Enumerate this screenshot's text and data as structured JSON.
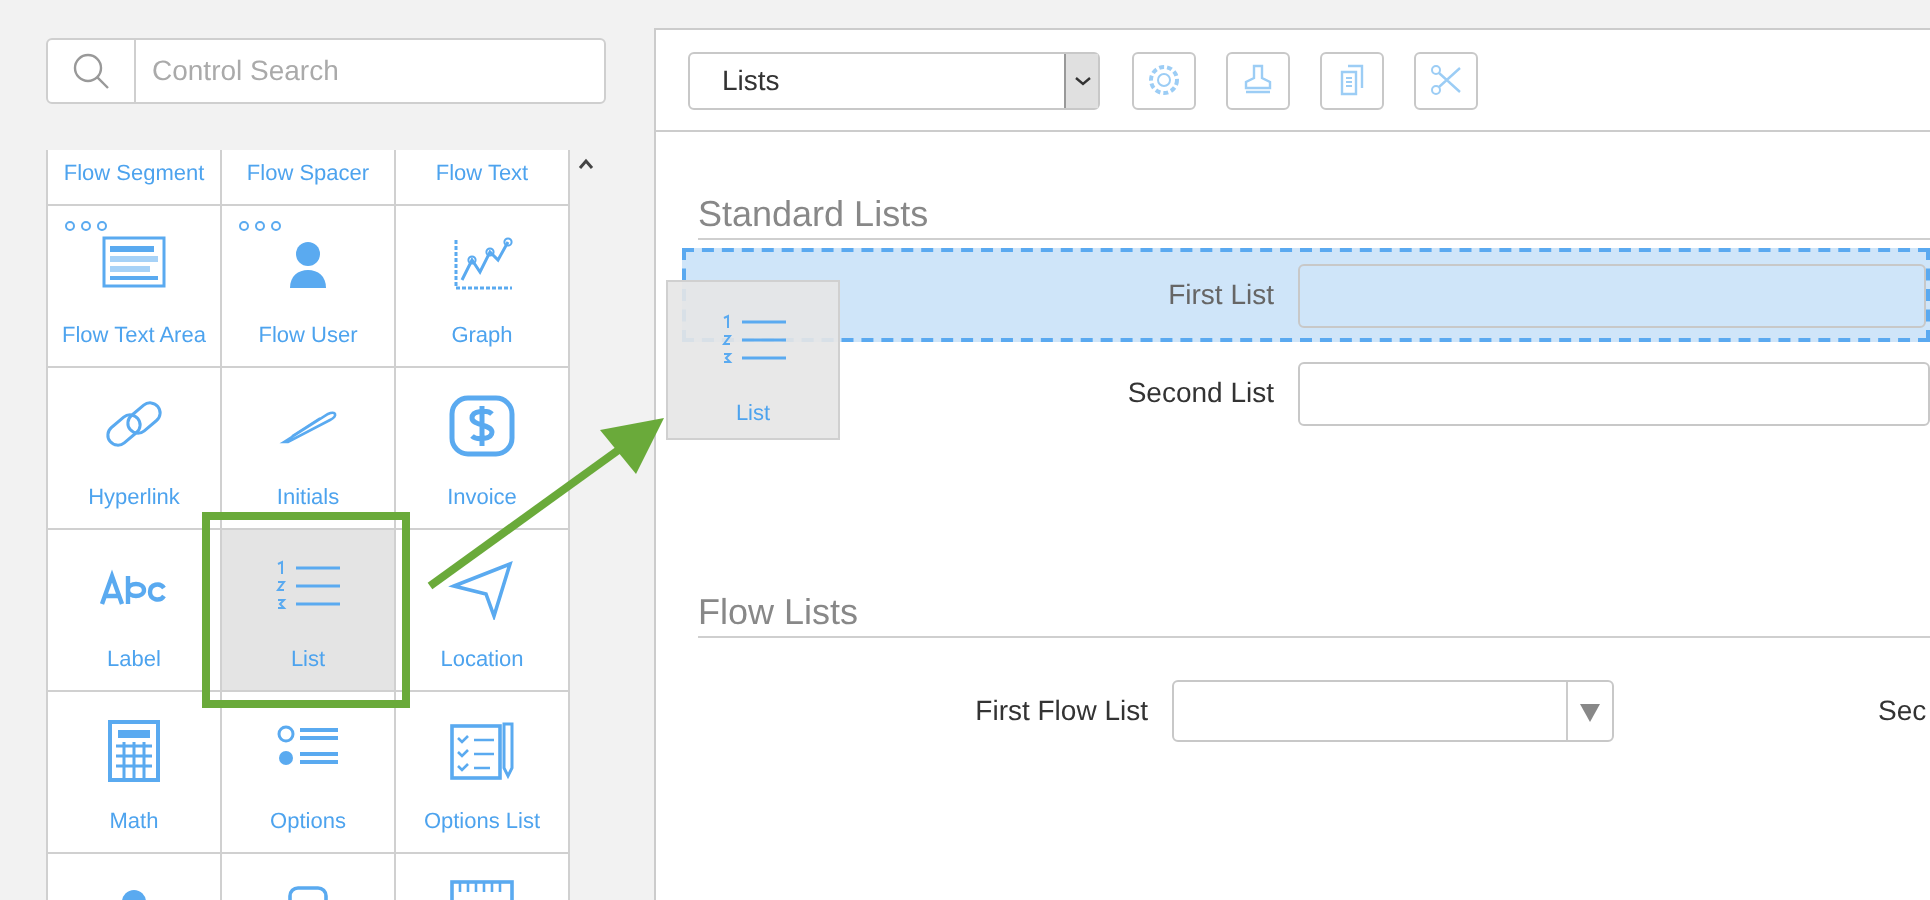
{
  "search": {
    "placeholder": "Control Search"
  },
  "palette": {
    "cells": [
      {
        "label": "Flow Segment",
        "kind": "none",
        "dots": false,
        "selected": false
      },
      {
        "label": "Flow Spacer",
        "kind": "none",
        "dots": false,
        "selected": false
      },
      {
        "label": "Flow Text",
        "kind": "none",
        "dots": false,
        "selected": false
      },
      {
        "label": "Flow Text Area",
        "kind": "textarea",
        "dots": true,
        "selected": false
      },
      {
        "label": "Flow User",
        "kind": "user",
        "dots": true,
        "selected": false
      },
      {
        "label": "Graph",
        "kind": "graph",
        "dots": false,
        "selected": false
      },
      {
        "label": "Hyperlink",
        "kind": "link",
        "dots": false,
        "selected": false
      },
      {
        "label": "Initials",
        "kind": "pen",
        "dots": false,
        "selected": false
      },
      {
        "label": "Invoice",
        "kind": "dollar",
        "dots": false,
        "selected": false
      },
      {
        "label": "Label",
        "kind": "abc",
        "dots": false,
        "selected": false
      },
      {
        "label": "List",
        "kind": "list",
        "dots": false,
        "selected": true
      },
      {
        "label": "Location",
        "kind": "location",
        "dots": false,
        "selected": false
      },
      {
        "label": "Math",
        "kind": "calculator",
        "dots": false,
        "selected": false
      },
      {
        "label": "Options",
        "kind": "options",
        "dots": false,
        "selected": false
      },
      {
        "label": "Options List",
        "kind": "checklist",
        "dots": false,
        "selected": false
      },
      {
        "kind": "user",
        "dots": false,
        "selected": false
      },
      {
        "kind": "field",
        "dots": false,
        "selected": false
      },
      {
        "kind": "ruler",
        "dots": false,
        "selected": false
      }
    ]
  },
  "toolbar": {
    "dropdown": "Lists",
    "buttons": [
      {
        "kind": "settings"
      },
      {
        "kind": "stamp"
      },
      {
        "kind": "copy"
      },
      {
        "kind": "cut"
      }
    ]
  },
  "sections": [
    {
      "title": "Standard Lists",
      "rows": [
        {
          "label": "First List",
          "kind": "text",
          "drop_target": true
        },
        {
          "label": "Second List",
          "kind": "text",
          "drop_target": false
        }
      ]
    },
    {
      "title": "Flow Lists",
      "rows": [
        {
          "label": "First Flow List",
          "kind": "dropdown",
          "drop_target": false,
          "next_label": "Sec"
        }
      ]
    }
  ],
  "drag_ghost": {
    "label": "List",
    "kind": "list"
  }
}
